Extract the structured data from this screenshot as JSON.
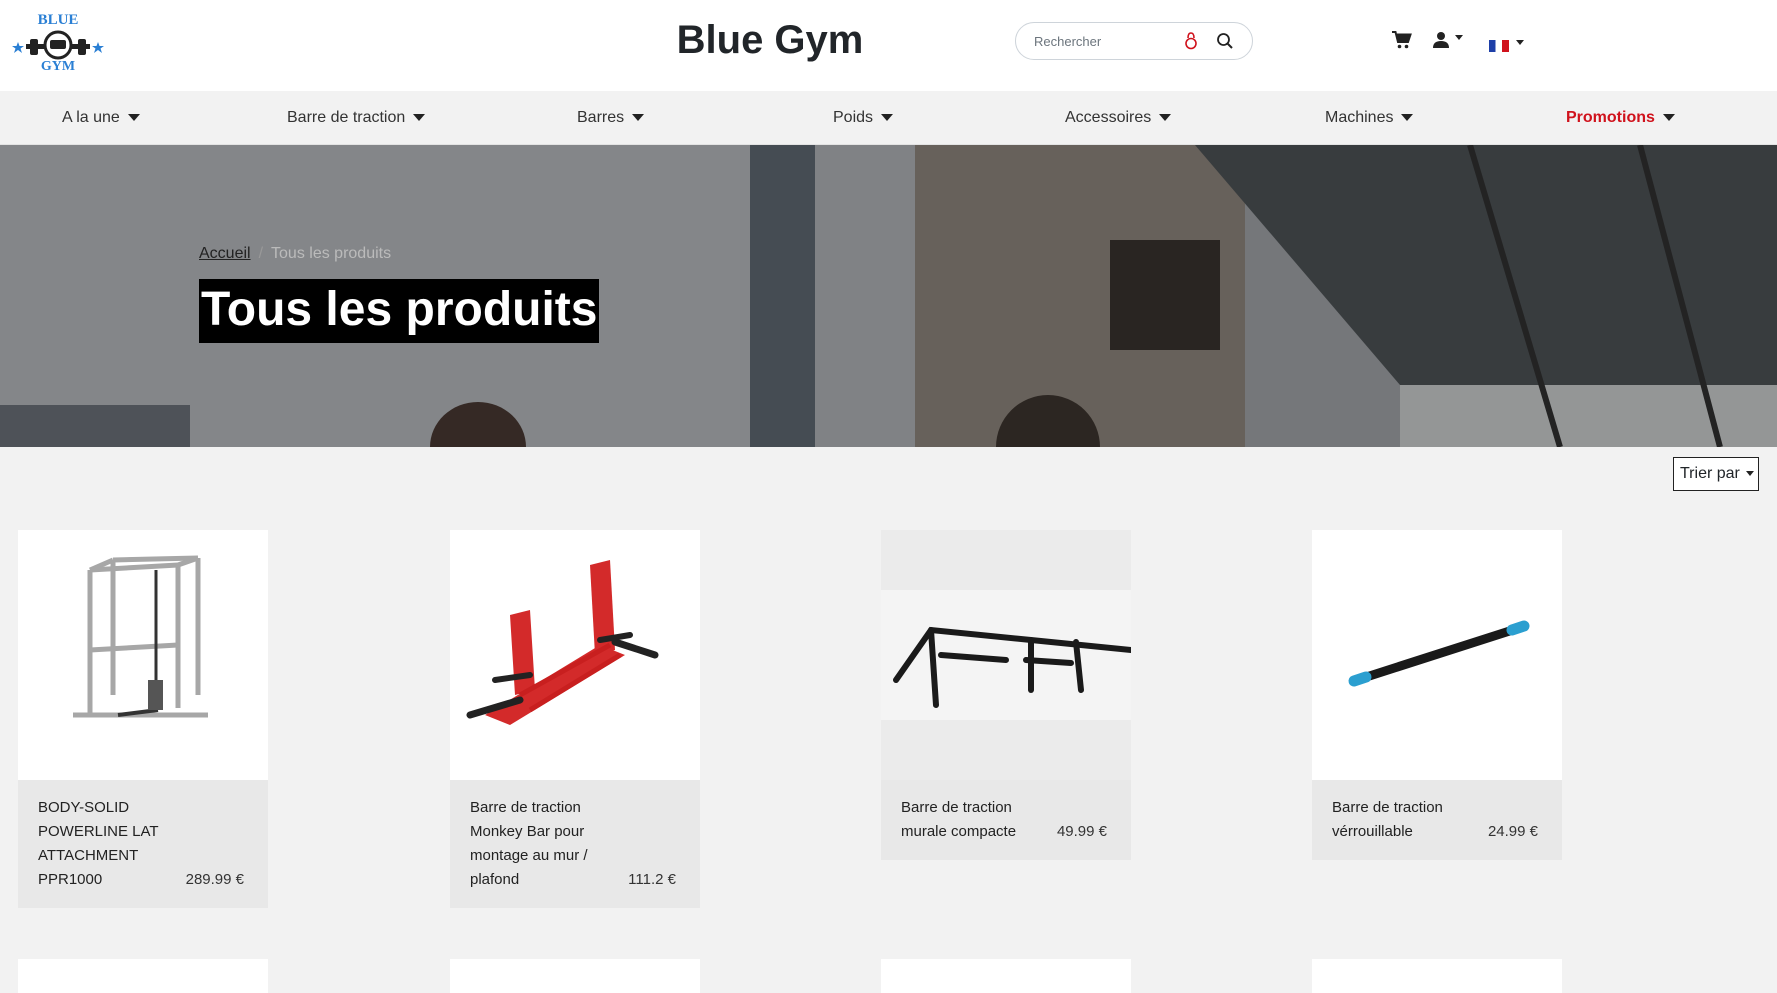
{
  "header": {
    "logo_text_top": "BLUE",
    "logo_text_bottom": "GYM",
    "site_title": "Blue Gym",
    "search_placeholder": "Rechercher",
    "icons": [
      "kettlebell-icon",
      "search-icon",
      "cart-icon",
      "user-icon",
      "flag-fr-icon"
    ]
  },
  "nav": {
    "items": [
      {
        "label": "A la une"
      },
      {
        "label": "Barre de traction"
      },
      {
        "label": "Barres"
      },
      {
        "label": "Poids"
      },
      {
        "label": "Accessoires"
      },
      {
        "label": "Machines"
      },
      {
        "label": "Promotions"
      }
    ]
  },
  "hero": {
    "breadcrumb_home": "Accueil",
    "breadcrumb_sep": "/",
    "breadcrumb_current": "Tous les produits",
    "title": "Tous les produits"
  },
  "sort": {
    "label": "Trier par"
  },
  "products": [
    {
      "name": "BODY-SOLID POWERLINE LAT ATTACHMENT PPR1000",
      "price": "289.99 €"
    },
    {
      "name": "Barre de traction Monkey Bar pour montage au mur / plafond",
      "price": "111.2 €"
    },
    {
      "name": "Barre de traction murale compacte",
      "price": "49.99 €"
    },
    {
      "name": "Barre de traction vérrouillable",
      "price": "24.99 €"
    }
  ],
  "colors": {
    "brand_blue": "#2a7fd4",
    "promo_red": "#d0121c",
    "title_bg": "#000000"
  }
}
